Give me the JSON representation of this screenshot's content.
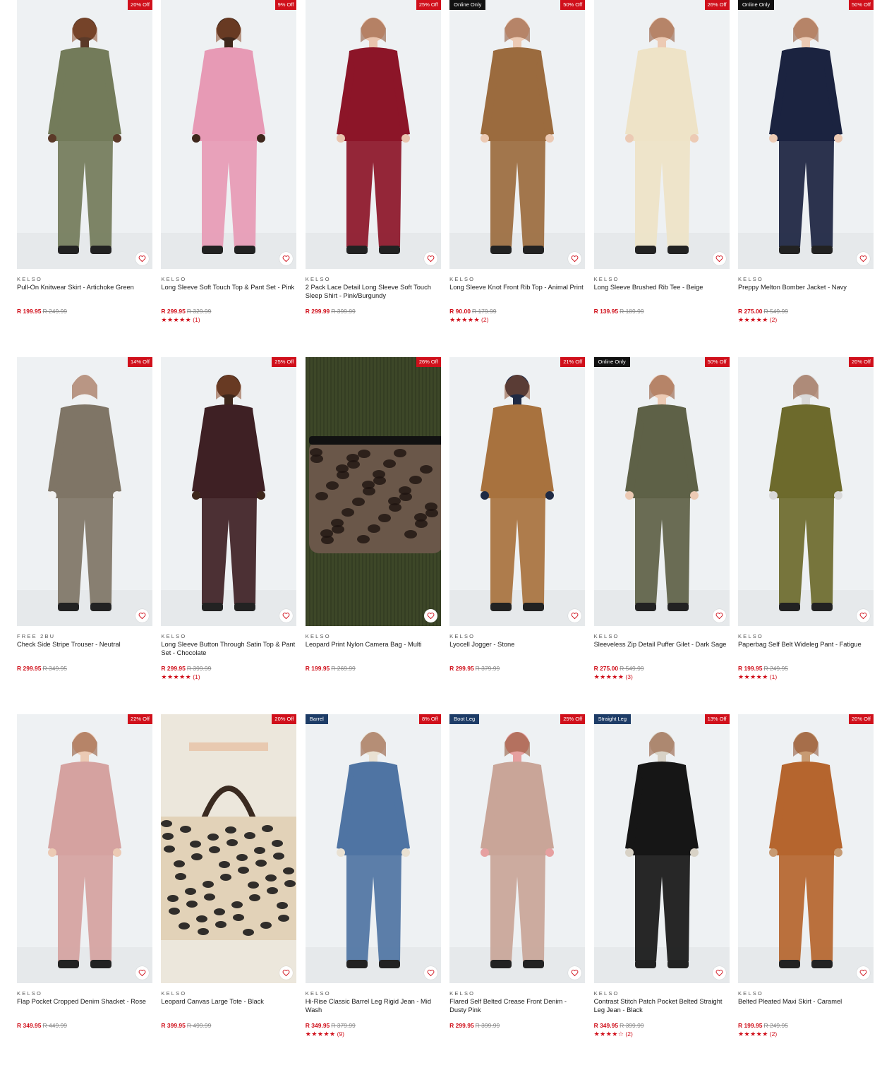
{
  "colors": {
    "sale_red": "#d0101b",
    "badge_black": "#111111",
    "tag_blue": "#1d3c67"
  },
  "products": [
    {
      "brand": "KELSO",
      "name": "Pull-On Knitwear Skirt - Artichoke Green",
      "price": "R 199.95",
      "was": "R 249.99",
      "discount": "20% Off",
      "left_badge": "",
      "rating": "",
      "reviews": "",
      "garment": "#737b5a",
      "skin": "#5b3a29",
      "bg": "#eef1f3",
      "icon": "heart-icon"
    },
    {
      "brand": "KELSO",
      "name": "Long Sleeve Soft Touch Top & Pant Set - Pink",
      "price": "R 299.95",
      "was": "R 329.99",
      "discount": "9% Off",
      "left_badge": "",
      "rating": "★★★★★",
      "reviews": "(1)",
      "garment": "#e79ab5",
      "skin": "#3e271c",
      "bg": "#eef1f3",
      "icon": "heart-icon"
    },
    {
      "brand": "KELSO",
      "name": "2 Pack Lace Detail Long Sleeve Soft Touch Sleep Shirt - Pink/Burgundy",
      "price": "R 299.99",
      "was": "R 399.99",
      "discount": "25% Off",
      "left_badge": "",
      "rating": "",
      "reviews": "",
      "garment": "#8c1528",
      "skin": "#e9c4ae",
      "bg": "#eef1f3",
      "icon": "heart-icon"
    },
    {
      "brand": "KELSO",
      "name": "Long Sleeve Knot Front Rib Top - Animal Print",
      "price": "R 90.00",
      "was": "R 179.99",
      "discount": "50% Off",
      "left_badge": "Online Only",
      "rating": "★★★★★",
      "reviews": "(2)",
      "garment": "#9b6b3e",
      "skin": "#eccab4",
      "bg": "#eef1f3",
      "icon": "heart-icon"
    },
    {
      "brand": "KELSO",
      "name": "Long Sleeve Brushed Rib Tee - Beige",
      "price": "R 139.95",
      "was": "R 189.99",
      "discount": "26% Off",
      "left_badge": "",
      "rating": "",
      "reviews": "",
      "garment": "#eee3c7",
      "skin": "#eccab4",
      "bg": "#eef1f3",
      "icon": "heart-icon"
    },
    {
      "brand": "KELSO",
      "name": "Preppy Melton Bomber Jacket - Navy",
      "price": "R 275.00",
      "was": "R 549.99",
      "discount": "50% Off",
      "left_badge": "Online Only",
      "rating": "★★★★★",
      "reviews": "(2)",
      "garment": "#1b2340",
      "skin": "#eccab4",
      "bg": "#eef1f3",
      "icon": "heart-icon"
    },
    {
      "brand": "FREE 2BU",
      "name": "Check Side Stripe Trouser - Neutral",
      "price": "R 299.95",
      "was": "R 349.95",
      "discount": "14% Off",
      "left_badge": "",
      "rating": "",
      "reviews": "",
      "garment": "#7f7566",
      "skin": "#f1f1f1",
      "bg": "#eef1f3",
      "icon": "heart-icon"
    },
    {
      "brand": "KELSO",
      "name": "Long Sleeve Button Through Satin Top & Pant Set - Chocolate",
      "price": "R 299.95",
      "was": "R 399.99",
      "discount": "25% Off",
      "left_badge": "",
      "rating": "★★★★★",
      "reviews": "(1)",
      "garment": "#3e2024",
      "skin": "#3e271c",
      "bg": "#eef1f3",
      "icon": "heart-icon"
    },
    {
      "brand": "KELSO",
      "name": "Leopard Print Nylon Camera Bag - Multi",
      "price": "R 199.95",
      "was": "R 269.99",
      "discount": "26% Off",
      "left_badge": "",
      "rating": "",
      "reviews": "",
      "garment": "#6a5749",
      "skin": "#3d4728",
      "bg": "#3d4728",
      "icon": "heart-icon"
    },
    {
      "brand": "KELSO",
      "name": "Lyocell Jogger - Stone",
      "price": "R 299.95",
      "was": "R 379.99",
      "discount": "21% Off",
      "left_badge": "",
      "rating": "",
      "reviews": "",
      "garment": "#a8723e",
      "skin": "#1f2a44",
      "bg": "#eef1f3",
      "icon": "heart-icon"
    },
    {
      "brand": "KELSO",
      "name": "Sleeveless Zip Detail Puffer Gilet - Dark Sage",
      "price": "R 275.00",
      "was": "R 549.99",
      "discount": "50% Off",
      "left_badge": "Online Only",
      "rating": "★★★★★",
      "reviews": "(3)",
      "garment": "#5e6147",
      "skin": "#eccab4",
      "bg": "#eef1f3",
      "icon": "heart-icon"
    },
    {
      "brand": "KELSO",
      "name": "Paperbag Self Belt Wideleg Pant - Fatigue",
      "price": "R 199.95",
      "was": "R 249.95",
      "discount": "20% Off",
      "left_badge": "",
      "rating": "★★★★★",
      "reviews": "(1)",
      "garment": "#6d6a2c",
      "skin": "#d9d9d9",
      "bg": "#eef1f3",
      "icon": "heart-icon"
    },
    {
      "brand": "KELSO",
      "name": "Flap Pocket Cropped Denim Shacket - Rose",
      "price": "R 349.95",
      "was": "R 449.99",
      "discount": "22% Off",
      "left_badge": "",
      "rating": "",
      "reviews": "",
      "garment": "#d5a2a0",
      "skin": "#eccab4",
      "bg": "#eef1f3",
      "icon": "heart-icon"
    },
    {
      "brand": "KELSO",
      "name": "Leopard Canvas Large Tote - Black",
      "price": "R 399.95",
      "was": "R 499.99",
      "discount": "20% Off",
      "left_badge": "",
      "rating": "",
      "reviews": "",
      "garment": "#e2d2b8",
      "skin": "#ece7dc",
      "bg": "#ece7dc",
      "icon": "heart-icon"
    },
    {
      "brand": "KELSO",
      "name": "Hi-Rise Classic Barrel Leg Rigid Jean - Mid Wash",
      "price": "R 349.95",
      "was": "R 379.99",
      "discount": "8% Off",
      "left_badge": "Barrel",
      "rating": "★★★★★",
      "reviews": "(9)",
      "garment": "#4f74a3",
      "skin": "#e9e1d2",
      "bg": "#eef1f3",
      "icon": "heart-icon"
    },
    {
      "brand": "KELSO",
      "name": "Flared Self Belted Crease Front Denim - Dusty Pink",
      "price": "R 299.95",
      "was": "R 399.99",
      "discount": "25% Off",
      "left_badge": "Boot Leg",
      "rating": "",
      "reviews": "",
      "garment": "#c9a598",
      "skin": "#e6a0a0",
      "bg": "#eef1f3",
      "icon": "heart-icon"
    },
    {
      "brand": "KELSO",
      "name": "Contrast Stitch Patch Pocket Belted Straight Leg Jean - Black",
      "price": "R 349.95",
      "was": "R 399.99",
      "discount": "13% Off",
      "left_badge": "Straight Leg",
      "rating": "★★★★☆",
      "reviews": "(2)",
      "garment": "#161616",
      "skin": "#d8d2c6",
      "bg": "#eef1f3",
      "icon": "heart-icon"
    },
    {
      "brand": "KELSO",
      "name": "Belted Pleated Maxi Skirt - Caramel",
      "price": "R 199.95",
      "was": "R 249.95",
      "discount": "20% Off",
      "left_badge": "",
      "rating": "★★★★★",
      "reviews": "(2)",
      "garment": "#b5652e",
      "skin": "#c79a72",
      "bg": "#eef1f3",
      "icon": "heart-icon"
    }
  ]
}
